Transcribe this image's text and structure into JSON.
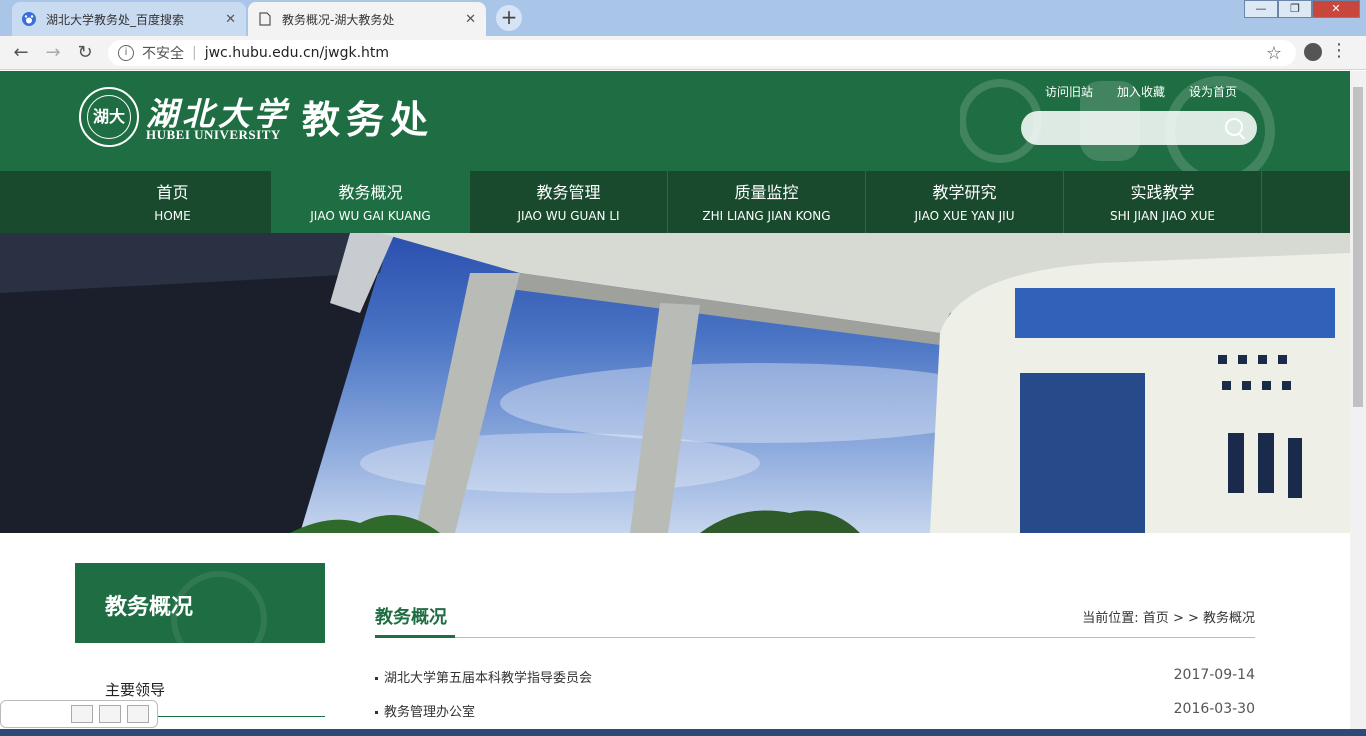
{
  "browser": {
    "tabs": [
      {
        "title": "湖北大学教务处_百度搜索",
        "active": false
      },
      {
        "title": "教务概况-湖大教务处",
        "active": true
      }
    ],
    "new_tab_label": "+",
    "back_glyph": "←",
    "forward_glyph": "→",
    "reload_glyph": "↻",
    "info_glyph": "i",
    "security_label": "不安全",
    "separator": "|",
    "url": "jwc.hubu.edu.cn/jwgk.htm",
    "bookmark_glyph": "☆",
    "menu_glyph": "⋮",
    "tab_close_glyph": "✕",
    "window_controls": [
      "—",
      "❐",
      "✕"
    ]
  },
  "header": {
    "logo_inner": "湖大",
    "logo_cn": "湖北大学",
    "logo_en": "HUBEI UNIVERSITY",
    "site_title": "教务处",
    "top_links": [
      "访问旧站",
      "加入收藏",
      "设为首页"
    ],
    "search_placeholder": ""
  },
  "nav": [
    {
      "cn": "首页",
      "en": "HOME",
      "active": false
    },
    {
      "cn": "教务概况",
      "en": "JIAO WU GAI KUANG",
      "active": true
    },
    {
      "cn": "教务管理",
      "en": "JIAO WU GUAN LI",
      "active": false
    },
    {
      "cn": "质量监控",
      "en": "ZHI LIANG JIAN KONG",
      "active": false
    },
    {
      "cn": "教学研究",
      "en": "JIAO XUE YAN JIU",
      "active": false
    },
    {
      "cn": "实践教学",
      "en": "SHI JIAN JIAO XUE",
      "active": false
    }
  ],
  "sidebar": {
    "title": "教务概况",
    "items": [
      "主要领导"
    ]
  },
  "main": {
    "title": "教务概况",
    "breadcrumb": "当前位置: 首页 > > 教务概况",
    "news": [
      {
        "title": "湖北大学第五届本科教学指导委员会",
        "date": "2017-09-14"
      },
      {
        "title": "教务管理办公室",
        "date": "2016-03-30"
      }
    ]
  },
  "colors": {
    "brand_green": "#1f6e43",
    "nav_dark": "#194a2e"
  }
}
